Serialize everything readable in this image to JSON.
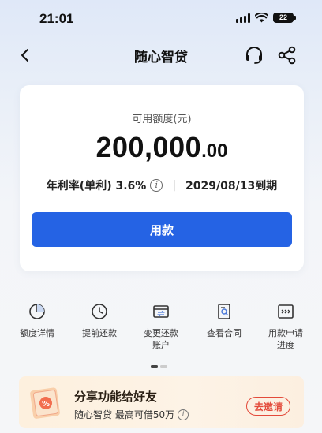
{
  "status_bar": {
    "time": "21:01",
    "battery": "22"
  },
  "nav": {
    "title": "随心智贷"
  },
  "credit": {
    "label": "可用额度(元)",
    "amount_int": "200,000",
    "amount_dec": ".00",
    "rate": "年利率(单利) 3.6%",
    "separator": "|",
    "due": "2029/08/13到期",
    "button": "用款"
  },
  "actions": [
    {
      "label": "额度详情",
      "icon": "pie-chart-icon"
    },
    {
      "label": "提前还款",
      "icon": "clock-icon"
    },
    {
      "label": "变更还款\n账户",
      "icon": "card-swap-icon"
    },
    {
      "label": "查看合同",
      "icon": "contract-search-icon"
    },
    {
      "label": "用款申请\n进度",
      "icon": "progress-arrows-icon"
    }
  ],
  "promo": {
    "title": "分享功能给好友",
    "subtitle": "随心智贷 最高可借50万",
    "button": "去邀请",
    "icon_text": "%"
  },
  "colors": {
    "primary": "#2563e4",
    "accent_red": "#e34a3a",
    "promo_bg": "#fdf0de"
  }
}
